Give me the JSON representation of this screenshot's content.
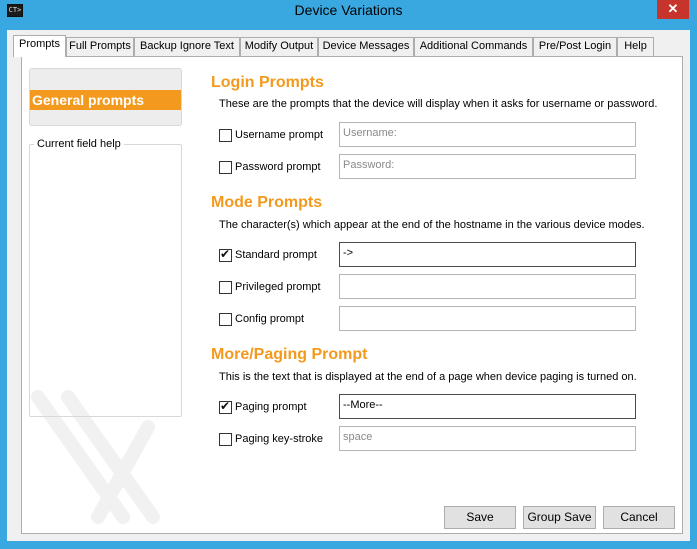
{
  "window": {
    "title": "Device Variations",
    "icon_text": "CT>",
    "close_glyph": "✕"
  },
  "tabs": [
    {
      "label": "Prompts",
      "active": true
    },
    {
      "label": "Full Prompts"
    },
    {
      "label": "Backup Ignore Text"
    },
    {
      "label": "Modify Output"
    },
    {
      "label": "Device Messages"
    },
    {
      "label": "Additional Commands"
    },
    {
      "label": "Pre/Post Login"
    },
    {
      "label": "Help"
    }
  ],
  "sidebar": {
    "section_label": "General prompts",
    "help_legend": "Current field help"
  },
  "login": {
    "heading": "Login Prompts",
    "desc": "These are the prompts that the device will display when it asks for username or password.",
    "username_label": "Username prompt",
    "username_placeholder": "Username:",
    "username_checked": false,
    "password_label": "Password prompt",
    "password_placeholder": "Password:",
    "password_checked": false
  },
  "mode": {
    "heading": "Mode Prompts",
    "desc": "The character(s) which appear at the end of the hostname in the various device modes.",
    "standard_label": "Standard prompt",
    "standard_value": "->",
    "standard_checked": true,
    "privileged_label": "Privileged prompt",
    "privileged_value": "",
    "privileged_checked": false,
    "config_label": "Config prompt",
    "config_value": "",
    "config_checked": false
  },
  "paging": {
    "heading": "More/Paging Prompt",
    "desc": "This is the text that is displayed at the end of a page when device paging is turned on.",
    "prompt_label": "Paging prompt",
    "prompt_value": "--More--",
    "prompt_checked": true,
    "keystroke_label": "Paging key-stroke",
    "keystroke_placeholder": "space",
    "keystroke_checked": false
  },
  "buttons": {
    "save": "Save",
    "group_save": "Group Save",
    "cancel": "Cancel"
  },
  "colors": {
    "accent": "#f39a1e",
    "titlebar": "#3aa8e0",
    "close": "#c7342b"
  }
}
